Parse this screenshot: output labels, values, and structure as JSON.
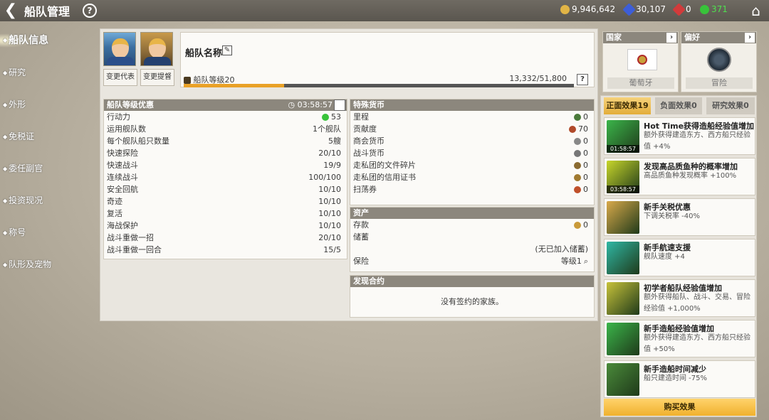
{
  "header": {
    "title": "船队管理",
    "resources": [
      {
        "name": "gold",
        "value": "9,946,642",
        "color": "#e2b546"
      },
      {
        "name": "blue-gem",
        "value": "30,107",
        "color": "#3d5ed8"
      },
      {
        "name": "red-gem",
        "value": "0",
        "color": "#d23b3b"
      },
      {
        "name": "green-gear",
        "value": "371",
        "color": "#38c33a"
      }
    ]
  },
  "sidebar": {
    "items": [
      {
        "label": "船队信息"
      },
      {
        "label": "研究"
      },
      {
        "label": "外形"
      },
      {
        "label": "免税证"
      },
      {
        "label": "委任副官"
      },
      {
        "label": "投资现况"
      },
      {
        "label": "称号"
      },
      {
        "label": "队形及宠物"
      }
    ]
  },
  "fleet": {
    "name": "船队名称",
    "change_rep": "变更代表",
    "change_admiral": "变更提督",
    "level_label": "船队等级20",
    "exp": "13,332/51,800",
    "exp_fraction": 0.2574,
    "help": "?"
  },
  "benefits": {
    "title": "船队等级优惠",
    "timer": "03:58:57",
    "rows": [
      {
        "label": "行动力",
        "value": "53"
      },
      {
        "label": "运用舰队数",
        "value": "1个舰队"
      },
      {
        "label": "每个舰队船只数量",
        "value": "5艘"
      },
      {
        "label": "快速探险",
        "value": "20/10"
      },
      {
        "label": "快速战斗",
        "value": "19/9"
      },
      {
        "label": "连续战斗",
        "value": "100/100"
      },
      {
        "label": "安全回航",
        "value": "10/10"
      },
      {
        "label": "奇迹",
        "value": "10/10"
      },
      {
        "label": "复活",
        "value": "10/10"
      },
      {
        "label": "海战保护",
        "value": "10/10"
      },
      {
        "label": "战斗重做一招",
        "value": "20/10"
      },
      {
        "label": "战斗重做一回合",
        "value": "15/5"
      }
    ]
  },
  "currency": {
    "title": "特殊货币",
    "rows": [
      {
        "label": "里程",
        "value": "0",
        "color": "#4a7a3a"
      },
      {
        "label": "贡献度",
        "value": "70",
        "color": "#b04a2a"
      },
      {
        "label": "商会货币",
        "value": "0",
        "color": "#888"
      },
      {
        "label": "战斗货币",
        "value": "0",
        "color": "#777"
      },
      {
        "label": "走私团的文件碎片",
        "value": "0",
        "color": "#8a6a30"
      },
      {
        "label": "走私团的信用证书",
        "value": "0",
        "color": "#a07a30"
      },
      {
        "label": "扫荡券",
        "value": "0",
        "color": "#c0502a"
      }
    ]
  },
  "assets": {
    "title": "资产",
    "deposit_label": "存款",
    "deposit_value": "0",
    "savings_label": "储蓄",
    "savings_note": "(无已加入储蓄)",
    "insurance_label": "保险",
    "insurance_value": "等级1"
  },
  "contract": {
    "title": "发现合约",
    "empty": "没有签约的家族。"
  },
  "nation": {
    "title": "国家",
    "value": "葡萄牙"
  },
  "preference": {
    "title": "偏好",
    "value": "冒险"
  },
  "effects": {
    "tabs": [
      {
        "label": "正面效果19"
      },
      {
        "label": "负面效果0"
      },
      {
        "label": "研究效果0"
      }
    ],
    "items": [
      {
        "title": "Hot Time获得造船经验值增加",
        "desc": "额外获得建造东方、西方船只经验值 +4%",
        "timer": "01:58:57",
        "icon": "ship-icon",
        "color": "#3bb54a"
      },
      {
        "title": "发现高品质鱼种的概率增加",
        "desc": "高品质鱼种发现概率 +100%",
        "timer": "03:58:57",
        "icon": "fishing-net-icon",
        "color": "#c8d62a"
      },
      {
        "title": "新手关税优惠",
        "desc": "下调关税率 -40%",
        "timer": "",
        "icon": "scale-icon",
        "color": "#d9a94a"
      },
      {
        "title": "新手航速支援",
        "desc": "舰队速度 +4",
        "timer": "",
        "icon": "sailing-ship-icon",
        "color": "#2fb7a4"
      },
      {
        "title": "初学者船队经验值增加",
        "desc": "额外获得船队、战斗、交易、冒险经验值 +1,000%",
        "timer": "",
        "icon": "medal-icon",
        "color": "#c7c23a"
      },
      {
        "title": "新手造船经验值增加",
        "desc": "额外获得建造东方、西方船只经验值 +50%",
        "timer": "",
        "icon": "ship-icon",
        "color": "#3bb54a"
      },
      {
        "title": "新手造船时间减少",
        "desc": "船只建造时间 -75%",
        "timer": "",
        "icon": "hammer-icon",
        "color": "#4a8a3a"
      }
    ],
    "buy_label": "购买效果"
  }
}
